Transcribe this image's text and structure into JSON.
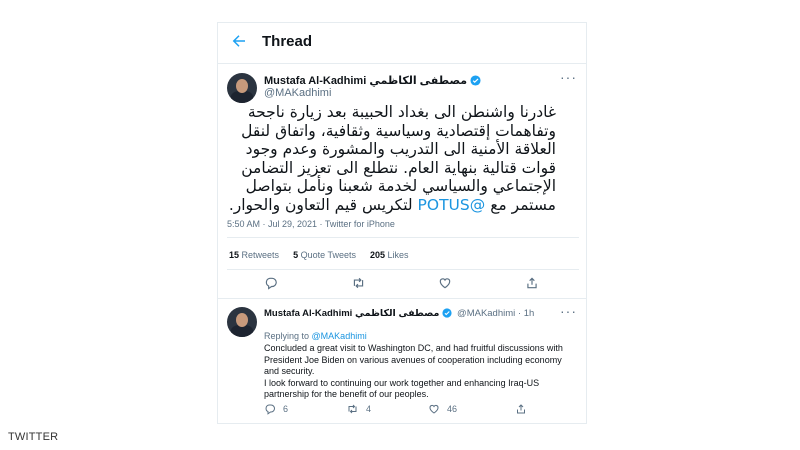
{
  "header": {
    "title": "Thread"
  },
  "main_tweet": {
    "display_name": "Mustafa Al-Kadhimi مصطفى الكاظمي",
    "handle": "@MAKadhimi",
    "text_before_mention": "غادرنا واشنطن الى بغداد الحبيبة بعد زيارة ناجحة وتفاهمات إقتصادية وسياسية وثقافية، واتفاق لنقل العلاقة الأمنية الى التدريب والمشورة وعدم وجود قوات قتالية بنهاية العام. نتطلع الى تعزيز التضامن الإجتماعي والسياسي لخدمة شعبنا ونأمل بتواصل مستمر مع",
    "mention": "@POTUS",
    "text_after_mention": "لتكريس قيم التعاون والحوار.",
    "timestamp": "5:50 AM · Jul 29, 2021 · Twitter for iPhone",
    "retweets": "15",
    "retweets_label": "Retweets",
    "quote_tweets": "5",
    "quote_tweets_label": "Quote Tweets",
    "likes": "205",
    "likes_label": "Likes"
  },
  "reply_tweet": {
    "display_name": "Mustafa Al-Kadhimi مصطفى الكاظمي",
    "handle_time": "@MAKadhimi · 1h",
    "replying_prefix": "Replying to",
    "replying_handle": "@MAKadhimi",
    "line1": "Concluded a great visit to Washington DC, and had fruitful discussions with",
    "line2": "President Joe Biden on various avenues of cooperation including economy",
    "line3": "and security.",
    "line4": "I look forward to continuing our work together and enhancing Iraq-US",
    "line5": "partnership for the benefit of our peoples.",
    "reply_count": "6",
    "retweet_count": "4",
    "like_count": "46"
  },
  "colors": {
    "accent": "#1da1f2",
    "text": "#0f1419",
    "muted": "#5b7083",
    "border": "#e6ecf0"
  },
  "icons": [
    "back-arrow-icon",
    "verified-icon",
    "more-icon",
    "reply-icon",
    "retweet-icon",
    "like-icon",
    "share-icon"
  ],
  "watermark": "TWITTER"
}
